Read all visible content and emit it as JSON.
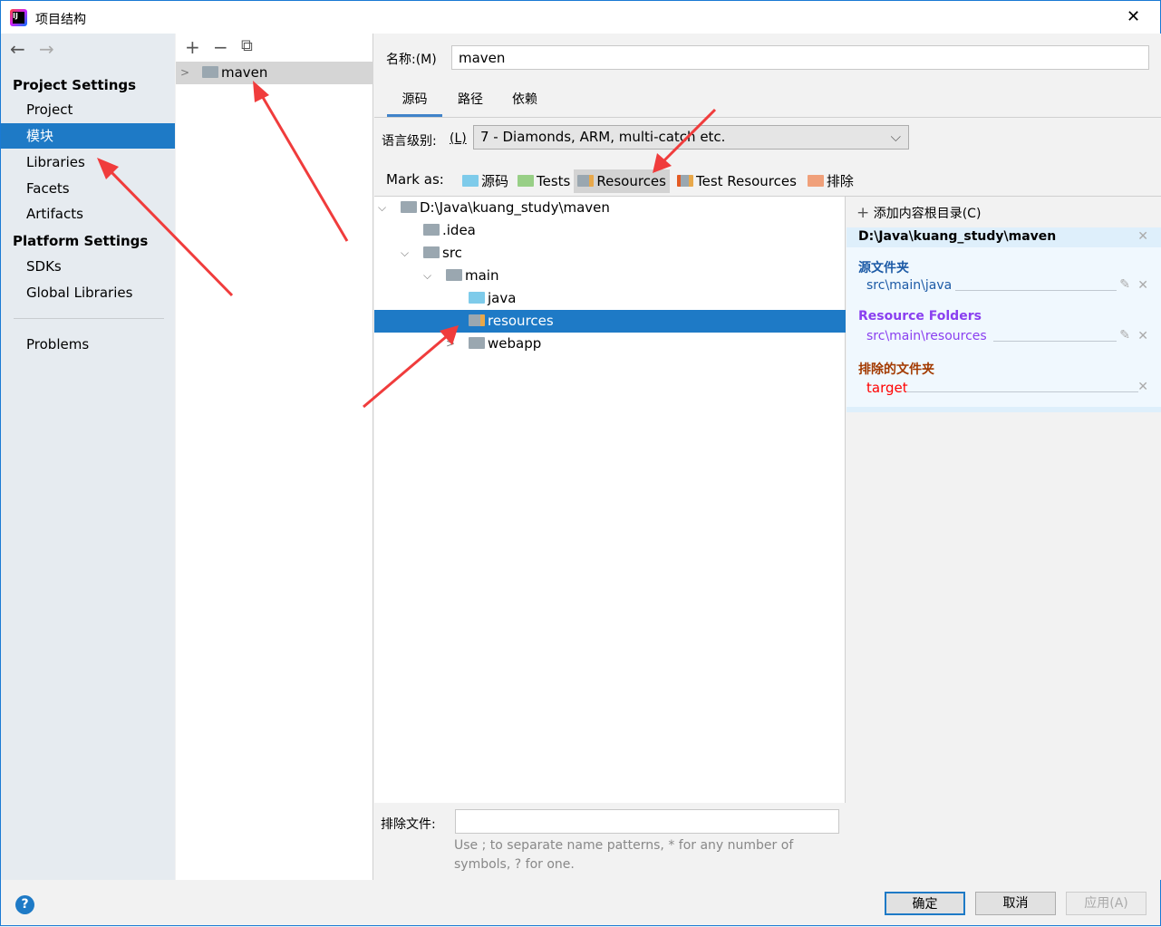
{
  "window": {
    "title": "项目结构",
    "close": "✕"
  },
  "nav": {
    "back": "←",
    "forward": "→"
  },
  "sidebar": {
    "project_settings": "Project Settings",
    "items1": [
      "Project",
      "模块",
      "Libraries",
      "Facets",
      "Artifacts"
    ],
    "platform_settings": "Platform Settings",
    "items2": [
      "SDKs",
      "Global Libraries"
    ],
    "problems": "Problems",
    "selected": "模块"
  },
  "modules": {
    "toolbar": [
      "+",
      "−",
      "⧉"
    ],
    "items": [
      "maven"
    ]
  },
  "name_field": {
    "label": "名称:(M)",
    "value": "maven"
  },
  "tabs": [
    "源码",
    "路径",
    "依赖"
  ],
  "active_tab": "源码",
  "language_level": {
    "label": "语言级别:",
    "mnemonic": "(L)",
    "value": "7 - Diamonds, ARM, multi-catch etc."
  },
  "mark_as": {
    "label": "Mark as:",
    "options": [
      {
        "label": "源码",
        "color": "#7ecbea"
      },
      {
        "label": "Tests",
        "color": "#98cf86"
      },
      {
        "label": "Resources",
        "color": "#9aa7b0"
      },
      {
        "label": "Test Resources",
        "color": "#9aa7b0"
      },
      {
        "label": "排除",
        "color": "#f0a07a"
      }
    ],
    "selected": "Resources"
  },
  "tree": [
    {
      "label": "D:\\Java\\kuang_study\\maven",
      "depth": 0,
      "expanded": true
    },
    {
      "label": ".idea",
      "depth": 1
    },
    {
      "label": "src",
      "depth": 1,
      "expanded": true
    },
    {
      "label": "main",
      "depth": 2,
      "expanded": true
    },
    {
      "label": "java",
      "depth": 3,
      "type": "source"
    },
    {
      "label": "resources",
      "depth": 3,
      "type": "resources",
      "selected": true
    },
    {
      "label": "webapp",
      "depth": 3,
      "collapsed": true
    }
  ],
  "content_roots": {
    "add_label": "添加内容根目录(C)",
    "root": "D:\\Java\\kuang_study\\maven",
    "source_header": "源文件夹",
    "source_path": "src\\main\\java",
    "resource_header": "Resource Folders",
    "resource_path": "src\\main\\resources",
    "excluded_header": "排除的文件夹",
    "excluded_path": "target"
  },
  "exclude_files": {
    "label": "排除文件:",
    "value": "",
    "hint": "Use ; to separate name patterns, * for any number of symbols, ? for one."
  },
  "buttons": {
    "ok": "确定",
    "cancel": "取消",
    "apply": "应用(A)",
    "help": "?"
  },
  "colors": {
    "accent": "#1e7ac6",
    "source": "#1c5aa6",
    "resource": "#8a3ff0",
    "excluded": "#a33a00",
    "excluded_path": "#ff0000",
    "annotation": "#f03c3c"
  }
}
